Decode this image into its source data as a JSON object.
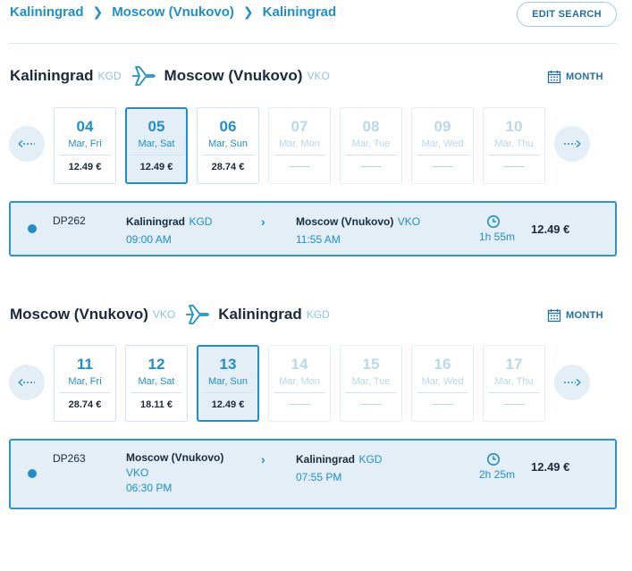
{
  "breadcrumb": [
    "Kaliningrad",
    "Moscow (Vnukovo)",
    "Kaliningrad"
  ],
  "edit_search": "EDIT SEARCH",
  "month_label": "MONTH",
  "colors": {
    "accent": "#1f8fc9",
    "selected_bg": "#e3eef7",
    "dark_text": "#1a2b3c",
    "disabled": "#b8d7ea"
  },
  "outbound": {
    "from_city": "Kaliningrad",
    "from_code": "KGD",
    "to_city": "Moscow (Vnukovo)",
    "to_code": "VKO",
    "days": [
      {
        "num": "04",
        "name": "Mar, Fri",
        "price": "12.49 €"
      },
      {
        "num": "05",
        "name": "Mar, Sat",
        "price": "12.49 €"
      },
      {
        "num": "06",
        "name": "Mar, Sun",
        "price": "28.74 €"
      },
      {
        "num": "07",
        "name": "Mar, Mon"
      },
      {
        "num": "08",
        "name": "Mar, Tue"
      },
      {
        "num": "09",
        "name": "Mar, Wed"
      },
      {
        "num": "10",
        "name": "Mar, Thu"
      }
    ],
    "flight": {
      "number": "DP262",
      "dep_city": "Kaliningrad",
      "dep_code": "KGD",
      "dep_time": "09:00 AM",
      "arr_city": "Moscow (Vnukovo)",
      "arr_code": "VKO",
      "arr_time": "11:55 AM",
      "duration": "1h 55m",
      "price": "12.49 €"
    }
  },
  "return": {
    "from_city": "Moscow (Vnukovo)",
    "from_code": "VKO",
    "to_city": "Kaliningrad",
    "to_code": "KGD",
    "days": [
      {
        "num": "11",
        "name": "Mar, Fri",
        "price": "28.74 €"
      },
      {
        "num": "12",
        "name": "Mar, Sat",
        "price": "18.11 €"
      },
      {
        "num": "13",
        "name": "Mar, Sun",
        "price": "12.49 €"
      },
      {
        "num": "14",
        "name": "Mar, Mon"
      },
      {
        "num": "15",
        "name": "Mar, Tue"
      },
      {
        "num": "16",
        "name": "Mar, Wed"
      },
      {
        "num": "17",
        "name": "Mar, Thu"
      }
    ],
    "flight": {
      "number": "DP263",
      "dep_city": "Moscow (Vnukovo)",
      "dep_code": "VKO",
      "dep_time": "06:30 PM",
      "arr_city": "Kaliningrad",
      "arr_code": "KGD",
      "arr_time": "07:55 PM",
      "duration": "2h 25m",
      "price": "12.49 €"
    }
  }
}
